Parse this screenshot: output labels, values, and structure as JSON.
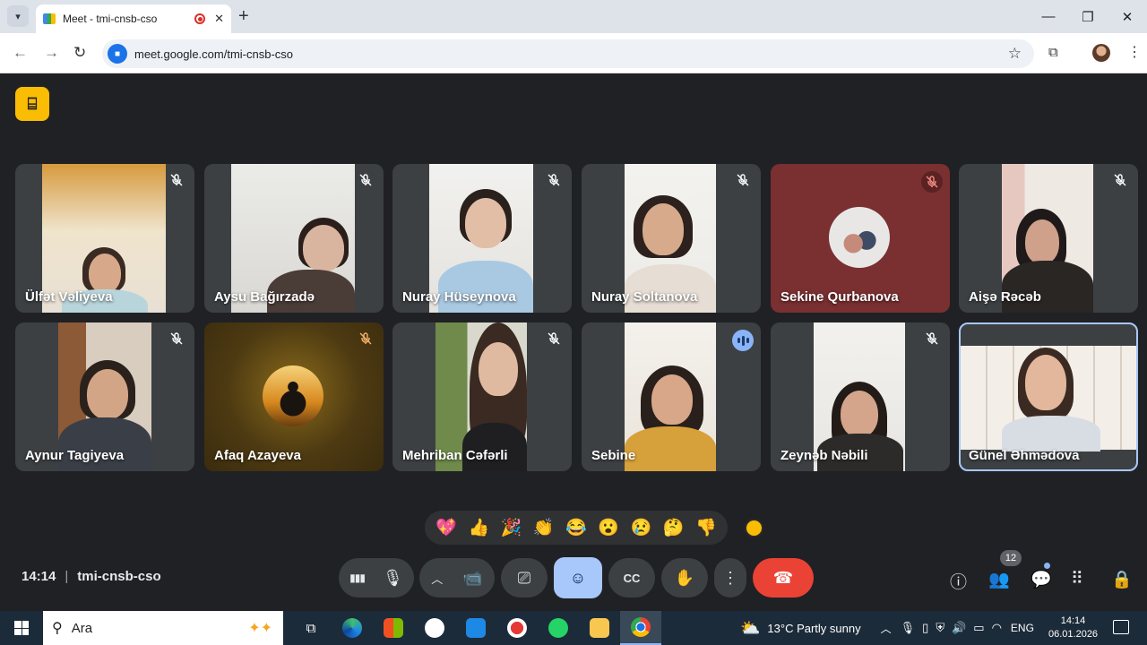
{
  "browser": {
    "tab_title": "Meet - tmi-cnsb-cso",
    "url": "meet.google.com/tmi-cnsb-cso"
  },
  "participants": [
    {
      "name": "Ülfət Vəliyeva"
    },
    {
      "name": "Aysu Bağırzadə"
    },
    {
      "name": "Nuray Hüseynova"
    },
    {
      "name": "Nuray Soltanova"
    },
    {
      "name": "Sekine Qurbanova"
    },
    {
      "name": "Aişə Rəcəb"
    },
    {
      "name": "Aynur Tagiyeva"
    },
    {
      "name": "Afaq Azayeva"
    },
    {
      "name": "Mehriban Cəfərli"
    },
    {
      "name": "Sebine"
    },
    {
      "name": "Zeynəb Nəbili"
    },
    {
      "name": "Günel Əhmədova"
    }
  ],
  "reactions": [
    "💖",
    "👍",
    "🎉",
    "👏",
    "😂",
    "😮",
    "😢",
    "🤔",
    "👎"
  ],
  "meeting": {
    "time": "14:14",
    "code": "tmi-cnsb-cso",
    "people_count": "12"
  },
  "taskbar": {
    "search_placeholder": "Ara",
    "weather": "13°C  Partly sunny",
    "language": "ENG",
    "time": "14:14",
    "date": "06.01.2026"
  },
  "colors": {
    "meet_bg": "#202124",
    "tile_bg": "#3c4043",
    "end_call": "#ea4335",
    "accent": "#a8c7fa"
  }
}
